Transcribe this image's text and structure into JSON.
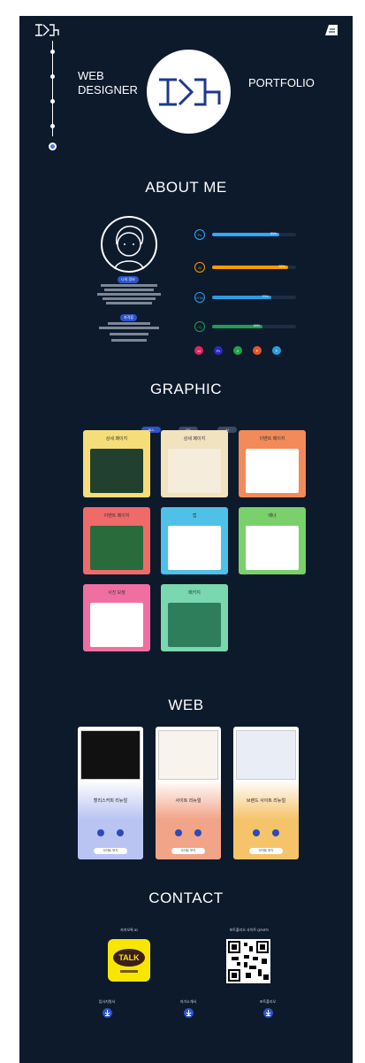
{
  "header": {
    "logo": "logo-mark",
    "menu_icon": "menu-icon"
  },
  "hero": {
    "left_line1": "WEB",
    "left_line2": "DESIGNER",
    "right": "PORTFOLIO"
  },
  "about": {
    "title": "ABOUT ME",
    "tag1": "나의 정보",
    "tag2": "자격증",
    "skills": [
      {
        "icon": "Ps",
        "pct": "80%",
        "value": 0.8,
        "color": "#31a8ff"
      },
      {
        "icon": "Ai",
        "pct": "90%",
        "value": 0.9,
        "color": "#ff9a00"
      },
      {
        "icon": "HTML",
        "pct": "70%",
        "value": 0.7,
        "color": "#2d9be0"
      },
      {
        "icon": "JQ",
        "pct": "60%",
        "value": 0.6,
        "color": "#1e9e54"
      }
    ],
    "tools": [
      {
        "icon": "Id",
        "color": "#e0245e"
      },
      {
        "icon": "Pr",
        "color": "#2a2abf"
      },
      {
        "icon": "X",
        "color": "#22a04a"
      },
      {
        "icon": "P",
        "color": "#e2562b"
      },
      {
        "icon": "F",
        "color": "#2d9be0"
      }
    ]
  },
  "graphic": {
    "title": "GRAPHIC",
    "filters": [
      "ALL",
      "PS",
      "AI"
    ],
    "cards": [
      {
        "title": "상세 페이지",
        "bg": "#f5de7a"
      },
      {
        "title": "상세 페이지",
        "bg": "#f1e2c0"
      },
      {
        "title": "이벤트 페이지",
        "bg": "#f28a5a"
      },
      {
        "title": "이벤트 페이지",
        "bg": "#f06a6a"
      },
      {
        "title": "앱",
        "bg": "#4fc0e8"
      },
      {
        "title": "배너",
        "bg": "#7ad06a"
      },
      {
        "title": "사진 보정",
        "bg": "#f06fa0"
      },
      {
        "title": "패키지",
        "bg": "#7ad7b0"
      }
    ]
  },
  "web": {
    "title": "WEB",
    "items": [
      {
        "title": "할리스커피 리뉴얼",
        "btn": "사이트 보기",
        "bg": "#b9c4f2"
      },
      {
        "title": "사이트 리뉴얼",
        "btn": "사이트 보기",
        "bg": "#f2a488"
      },
      {
        "title": "브랜드 사이트 리뉴얼",
        "btn": "사이트 보기",
        "bg": "#f5c36a"
      }
    ]
  },
  "contact": {
    "title": "CONTACT",
    "kakao_label": "카카오톡 ID",
    "qr_label": "포트폴리오 사이트 QR코드",
    "talk": "TALK",
    "downloads": [
      "입사지원서",
      "자기소개서",
      "포트폴리오"
    ]
  }
}
